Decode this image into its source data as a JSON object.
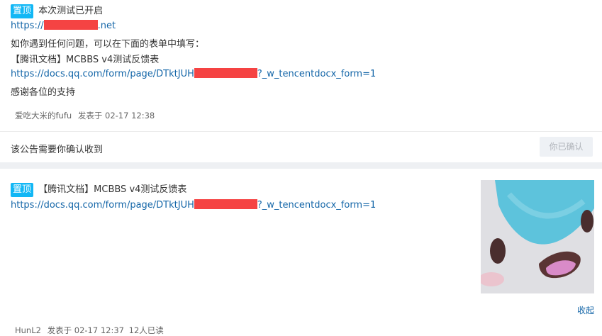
{
  "post1": {
    "badge": "置顶",
    "title": "本次测试已开启",
    "url_prefix": "https://",
    "url_suffix": ".net",
    "line_intro": "如你遇到任何问题，可以在下面的表单中填写：",
    "form_name": "【腾讯文档】MCBBS v4测试反馈表",
    "form_url_prefix": "https://docs.qq.com/form/page/DTktJUH",
    "form_url_suffix": "?_w_tencentdocx_form=1",
    "thanks": "感谢各位的支持",
    "author": "爱吃大米的fufu",
    "posted": "发表于 02-17 12:38"
  },
  "confirm_bar": {
    "text": "该公告需要你确认收到",
    "button": "你已确认"
  },
  "post2": {
    "badge": "置顶",
    "title": "【腾讯文档】MCBBS v4测试反馈表",
    "form_url_prefix": "https://docs.qq.com/form/page/DTktJUH",
    "form_url_suffix": "?_w_tencentdocx_form=1",
    "collapse": "收起",
    "author": "HunL2",
    "posted": "发表于 02-17 12:37",
    "read_count": "12人已读"
  },
  "colors": {
    "badge": "#12b7f5",
    "link": "#1466a8",
    "redaction": "#f54343"
  }
}
